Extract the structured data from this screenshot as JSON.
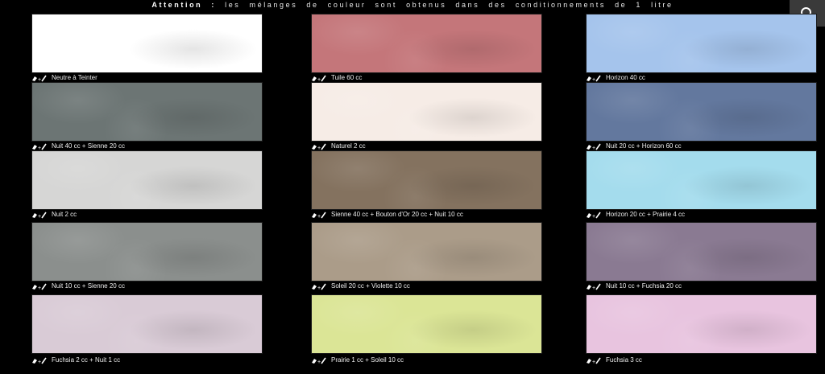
{
  "notice": {
    "label": "Attention :",
    "text": "les mélanges de couleur sont obtenus dans des conditionnements de 1 litre"
  },
  "search": {
    "icon": "search-icon"
  },
  "swatch_icon": "paint-mix-icon",
  "columns": [
    {
      "swatches": [
        {
          "label": "Neutre à Teinter",
          "color": "#ffffff"
        },
        {
          "label": "Nuit 40 cc + Sienne 20 cc",
          "color": "#6c7574"
        },
        {
          "label": "Nuit 2 cc",
          "color": "#d6d6d5"
        },
        {
          "label": "Nuit 10 cc + Sienne 20 cc",
          "color": "#8b8f8d"
        },
        {
          "label": "Fuchsia 2 cc + Nuit 1 cc",
          "color": "#d9cbd6"
        }
      ]
    },
    {
      "swatches": [
        {
          "label": "Tuile 60 cc",
          "color": "#c4767a"
        },
        {
          "label": "Naturel 2 cc",
          "color": "#f6ece6"
        },
        {
          "label": "Sienne 40 cc + Bouton d'Or 20 cc + Nuit 10 cc",
          "color": "#84725f"
        },
        {
          "label": "Soleil 20 cc + Violette 10 cc",
          "color": "#ab9c89"
        },
        {
          "label": "Prairie 1 cc + Soleil 10 cc",
          "color": "#dbe596"
        }
      ]
    },
    {
      "swatches": [
        {
          "label": "Horizon 40 cc",
          "color": "#a5c4ec"
        },
        {
          "label": "Nuit 20 cc + Horizon 60 cc",
          "color": "#63789e"
        },
        {
          "label": "Horizon 20 cc + Prairie 4 cc",
          "color": "#a4dced"
        },
        {
          "label": "Nuit 10 cc + Fuchsia 20 cc",
          "color": "#8a7a92"
        },
        {
          "label": "Fuchsia 3 cc",
          "color": "#e8c4df"
        }
      ]
    }
  ]
}
